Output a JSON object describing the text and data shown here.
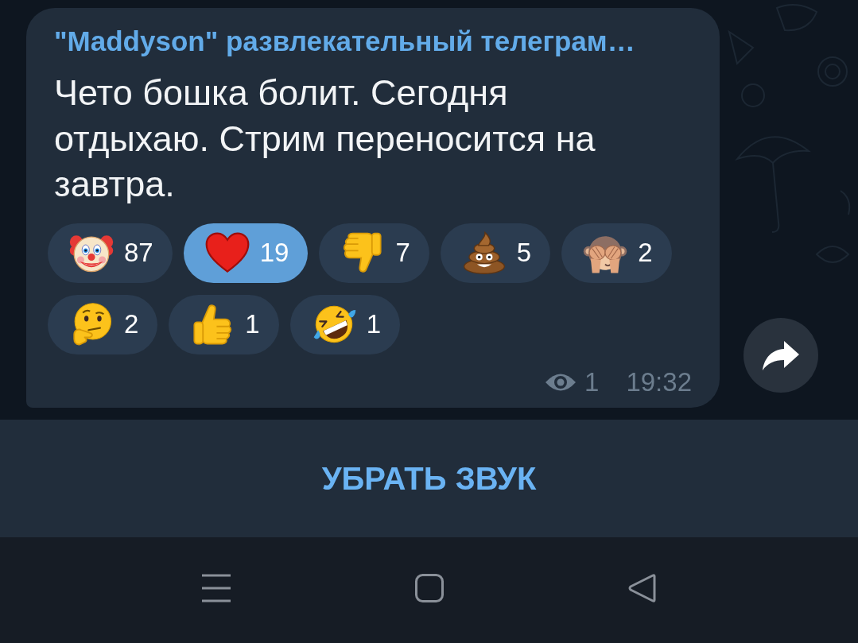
{
  "message": {
    "forwarded_from": "\"Maddyson\" развлекательный телеграм…",
    "text": "Чето бошка болит. Сегодня отдыхаю. Стрим переносится на завтра.",
    "reactions": [
      {
        "kind": "clown",
        "count": "87",
        "selected": false
      },
      {
        "kind": "heart",
        "count": "19",
        "selected": true
      },
      {
        "kind": "thumbs-down",
        "count": "7",
        "selected": false
      },
      {
        "kind": "poop",
        "count": "5",
        "selected": false
      },
      {
        "kind": "monkey",
        "count": "2",
        "selected": false
      },
      {
        "kind": "thinking",
        "count": "2",
        "selected": false
      },
      {
        "kind": "thumbs-up",
        "count": "1",
        "selected": false
      },
      {
        "kind": "rofl",
        "count": "1",
        "selected": false
      }
    ],
    "views": "1",
    "time": "19:32"
  },
  "mute_button": {
    "label": "УБРАТЬ ЗВУК"
  }
}
